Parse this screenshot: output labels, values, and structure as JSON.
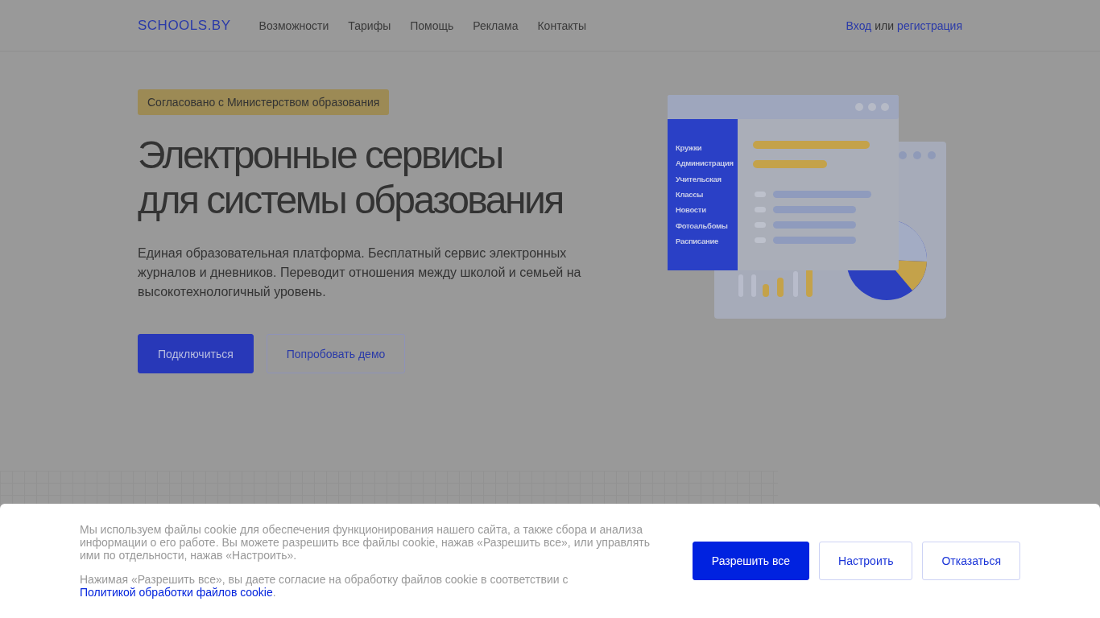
{
  "header": {
    "logo": "SCHOOLS.BY",
    "nav": [
      "Возможности",
      "Тарифы",
      "Помощь",
      "Реклама",
      "Контакты"
    ],
    "login": "Вход",
    "or": "или",
    "register": "регистрация"
  },
  "hero": {
    "badge": "Согласовано с Министерством образования",
    "title_lines": [
      "Электронные сервисы",
      "для системы образования"
    ],
    "description": "Единая образовательная платформа. Бесплатный сервис электронных журналов и дневников. Переводит отношения между школой и семьей на высокотехнологичный уровень.",
    "buttons": [
      {
        "label": "Подключиться",
        "kind": "primary"
      },
      {
        "label": "Попробовать демо",
        "kind": "outline"
      }
    ]
  },
  "illustration": {
    "menu_items": [
      "Кружки",
      "Администрация",
      "Учительская",
      "Классы",
      "Новости",
      "Фотоальбомы",
      "Расписание"
    ]
  },
  "cookie_banner": {
    "text": "Мы используем файлы cookie для обеспечения функционирования нашего сайта, а также сбора и анализа информации о его работе. Вы можете разрешить все файлы cookie, нажав «Разрешить все», или управлять ими по отдельности, нажав «Настроить».",
    "consent_text": "Нажимая «Разрешить все», вы даете согласие на обработку файлов cookie в соответствии с",
    "policy_link": "Политикой обработки файлов cookie",
    "end": ".",
    "buttons": [
      {
        "label": "Разрешить все",
        "kind": "primary"
      },
      {
        "label": "Настроить",
        "kind": "outline"
      },
      {
        "label": "Отказаться",
        "kind": "outline"
      }
    ]
  }
}
